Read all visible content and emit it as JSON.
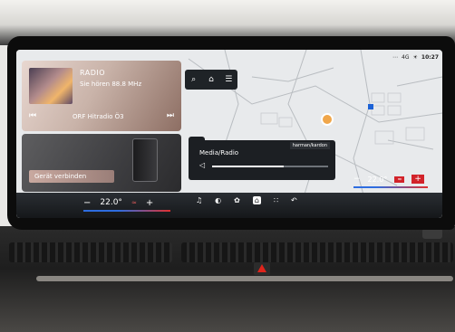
{
  "status": {
    "signal": "⋯",
    "network": "4G",
    "temp_icon": "☀",
    "time": "10:27"
  },
  "radio": {
    "title": "RADIO",
    "subtitle": "Sie hören 88.8 MHz",
    "station": "ORF Hitradio Ö3",
    "prev_icon": "⏮",
    "next_icon": "⏭"
  },
  "device": {
    "connect_label": "Gerät verbinden"
  },
  "map_tools": {
    "search_icon": "⌕",
    "home_icon": "⌂",
    "list_icon": "☰"
  },
  "media": {
    "label": "Media/Radio",
    "brand": "harman/kardon",
    "speaker_icon": "◁",
    "volume": 0.62
  },
  "climate": {
    "left": {
      "minus": "−",
      "temp": "22.0°",
      "plus": "+"
    },
    "right": {
      "minus": "−",
      "temp": "22.0°",
      "seat": "≈",
      "plus": "+"
    }
  },
  "nav": {
    "items": [
      {
        "name": "media-nav-icon",
        "glyph": "♫"
      },
      {
        "name": "phone-nav-icon",
        "glyph": "◐"
      },
      {
        "name": "fan-nav-icon",
        "glyph": "✿"
      },
      {
        "name": "home-nav-icon",
        "glyph": "⌂"
      },
      {
        "name": "apps-nav-icon",
        "glyph": "∷"
      },
      {
        "name": "back-nav-icon",
        "glyph": "↶"
      }
    ]
  }
}
